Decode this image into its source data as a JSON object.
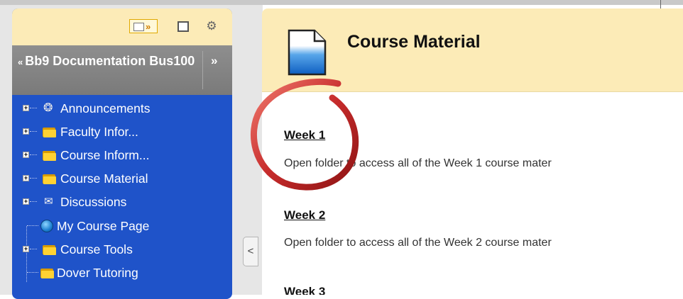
{
  "sidebar": {
    "course_title": "Bb9 Documentation Bus100",
    "collapse_glyph": "«",
    "expand_glyph": "»",
    "toolbar": {
      "chevron": "»",
      "gear": "⚙"
    },
    "items": [
      {
        "label": "Announcements",
        "icon": "announcement-icon",
        "expandable": true
      },
      {
        "label": "Faculty Infor...",
        "icon": "folder-icon",
        "expandable": true
      },
      {
        "label": "Course Inform...",
        "icon": "folder-icon",
        "expandable": true
      },
      {
        "label": "Course Material",
        "icon": "folder-icon",
        "expandable": true
      },
      {
        "label": "Discussions",
        "icon": "discussion-icon",
        "expandable": true
      },
      {
        "label": "My Course Page",
        "icon": "globe-icon",
        "expandable": false
      },
      {
        "label": "Course Tools",
        "icon": "folder-icon",
        "expandable": true
      },
      {
        "label": "Dover Tutoring",
        "icon": "folder-icon",
        "expandable": false
      }
    ]
  },
  "collapse_tab": {
    "glyph": "<"
  },
  "main": {
    "title": "Course Material",
    "items": [
      {
        "title": "Week 1",
        "description": "Open folder to access all of the Week 1 course mater"
      },
      {
        "title": "Week 2",
        "description": "Open folder to access all of the Week 2 course mater"
      },
      {
        "title": "Week 3",
        "description": ""
      }
    ]
  },
  "colors": {
    "menu_background": "#1f53c9",
    "header_background": "#fcebb7",
    "sidebar_header": "#8e8e8e",
    "highlight_ring": "#c62b2b"
  }
}
